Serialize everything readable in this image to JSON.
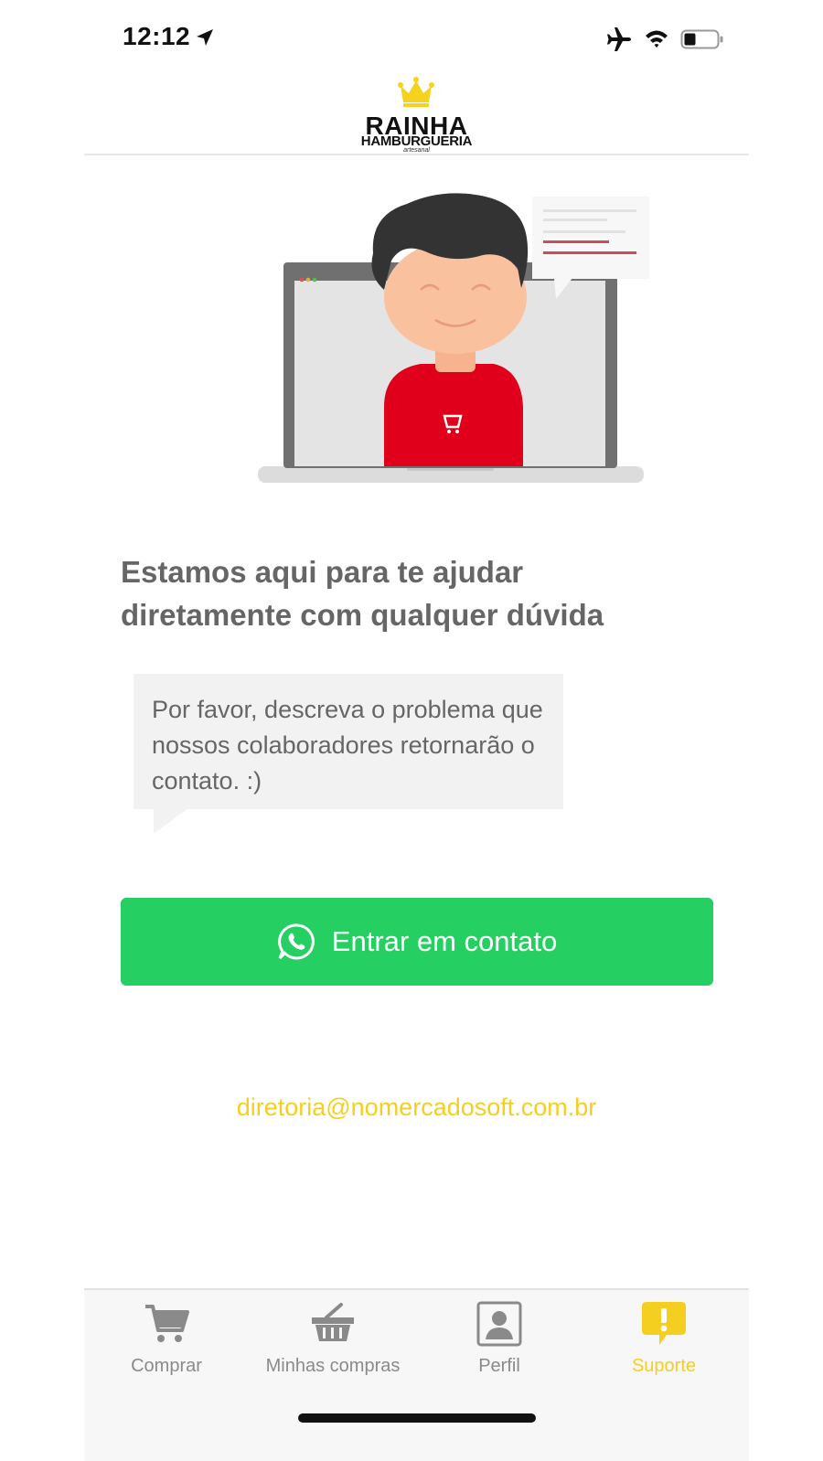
{
  "status_bar": {
    "time": "12:12",
    "icons": [
      "location-arrow-icon",
      "airplane-icon",
      "wifi-icon",
      "battery-icon"
    ]
  },
  "header": {
    "logo_name": "RAINHA",
    "logo_subtitle": "HAMBURGUERIA",
    "logo_tagline": "artesanal",
    "crown_color": "#f5d21e"
  },
  "illustration": {
    "shirt_color": "#e0001b",
    "laptop_color": "#707070"
  },
  "main": {
    "headline": "Estamos aqui para te ajudar diretamente com qualquer dúvida",
    "bubble_text": "Por favor, descreva o problema que nossos colaboradores retornarão o contato. :)",
    "contact_button_label": "Entrar em contato",
    "contact_button_color": "#25cf62",
    "email": "diretoria@nomercadosoft.com.br",
    "email_color": "#f5cf1f"
  },
  "tab_bar": {
    "active_color": "#f5cf1f",
    "inactive_color": "#8a8a8a",
    "tabs": [
      {
        "label": "Comprar",
        "icon": "cart-icon",
        "active": false
      },
      {
        "label": "Minhas compras",
        "icon": "basket-icon",
        "active": false
      },
      {
        "label": "Perfil",
        "icon": "profile-icon",
        "active": false
      },
      {
        "label": "Suporte",
        "icon": "support-alert-icon",
        "active": true
      }
    ]
  }
}
